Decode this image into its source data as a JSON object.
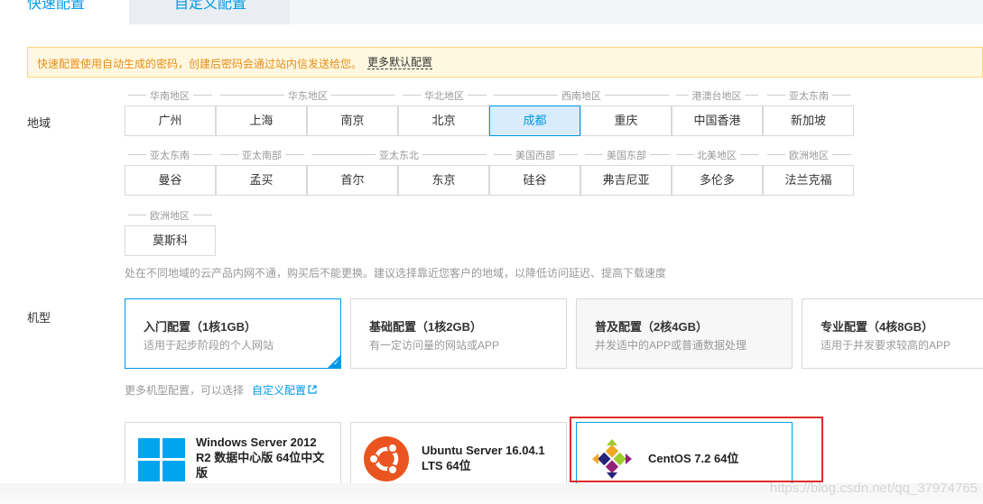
{
  "tabs": {
    "quick": "快速配置",
    "custom": "自定义配置"
  },
  "notice": {
    "text": "快速配置使用自动生成的密码，创建后密码会通过站内信发送给您。",
    "link": "更多默认配置"
  },
  "region": {
    "label": "地域",
    "groups": [
      "华南地区",
      "华东地区",
      "华北地区",
      "西南地区",
      "港澳台地区",
      "亚太东南",
      "亚太东南",
      "亚太南部",
      "亚太东北",
      "美国西部",
      "美国东部",
      "北美地区",
      "欧洲地区",
      "欧洲地区"
    ],
    "cities": [
      "广州",
      "上海",
      "南京",
      "北京",
      "成都",
      "重庆",
      "中国香港",
      "新加坡",
      "曼谷",
      "孟买",
      "首尔",
      "东京",
      "硅谷",
      "弗吉尼亚",
      "多伦多",
      "法兰克福",
      "莫斯科"
    ],
    "selected": "成都",
    "hint": "处在不同地域的云产品内网不通，购买后不能更换。建议选择靠近您客户的地域，以降低访问延迟、提高下载速度"
  },
  "machine": {
    "label": "机型",
    "cards": [
      {
        "title": "入门配置（1核1GB）",
        "sub": "适用于起步阶段的个人网站"
      },
      {
        "title": "基础配置（1核2GB）",
        "sub": "有一定访问量的网站或APP"
      },
      {
        "title": "普及配置（2核4GB）",
        "sub": "并发适中的APP或普通数据处理"
      },
      {
        "title": "专业配置（4核8GB）",
        "sub": "适用于并发要求较高的APP"
      }
    ],
    "more_text": "更多机型配置，可以选择",
    "more_link": "自定义配置"
  },
  "os": {
    "windows": [
      "Windows Server 2012",
      "R2 数据中心版 64位中文",
      "版"
    ],
    "ubuntu": [
      "Ubuntu Server 16.04.1",
      "LTS 64位"
    ],
    "centos": "CentOS 7.2 64位"
  },
  "watermark": "https://blog.csdn.net/qq_37974765",
  "colors": {
    "accent": "#0099e6",
    "notice_bg": "#fff8e1",
    "highlight_box": "#e02b2b"
  }
}
